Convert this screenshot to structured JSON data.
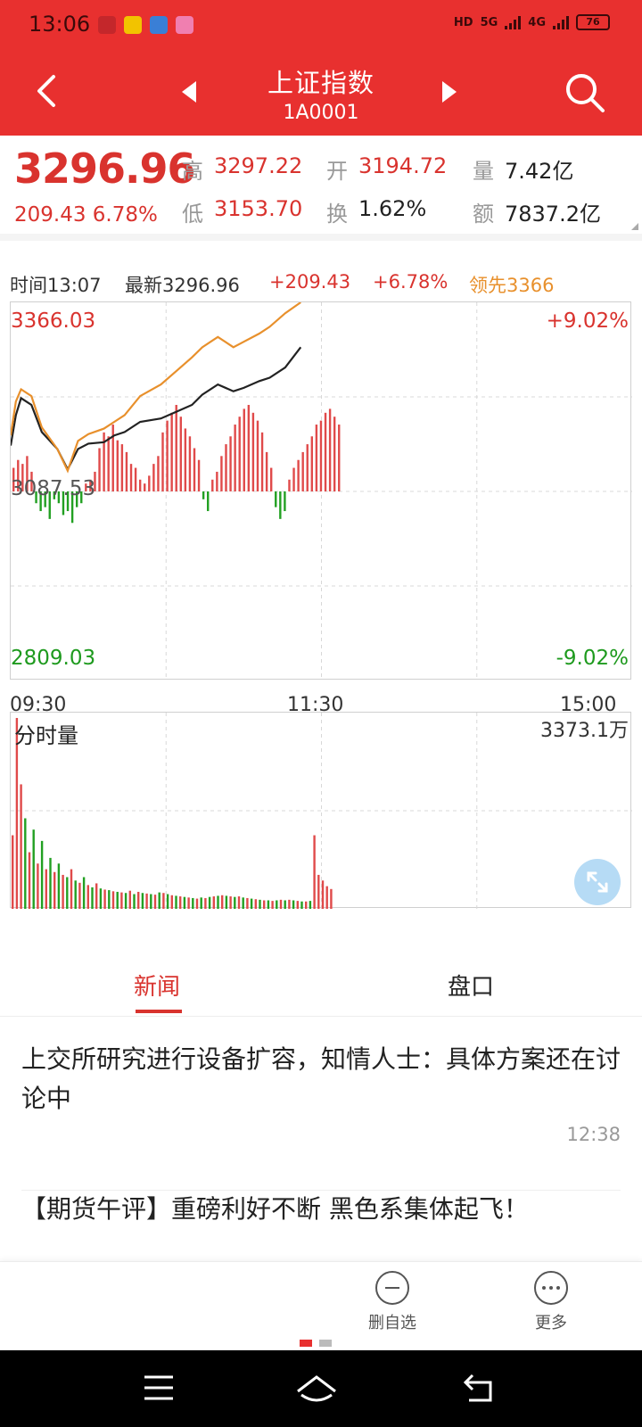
{
  "status_bar": {
    "time": "13:06",
    "network": "5G",
    "network2": "4G",
    "battery": "76",
    "app_colors": [
      "#c4272b",
      "#f2c300",
      "#3a7fd6",
      "#f07fb0"
    ]
  },
  "header": {
    "title": "上证指数",
    "code": "1A0001"
  },
  "quote": {
    "price": "3296.96",
    "change": "209.43",
    "change_pct": "6.78%",
    "high_label": "高",
    "high": "3297.22",
    "low_label": "低",
    "low": "3153.70",
    "open_label": "开",
    "open": "3194.72",
    "turnover_label": "换",
    "turnover": "1.62%",
    "volume_label": "量",
    "volume": "7.42亿",
    "amount_label": "额",
    "amount": "7837.2亿"
  },
  "info_row": {
    "time": "时间13:07",
    "latest": "最新3296.96",
    "change": "+209.43",
    "change_pct": "+6.78%",
    "lead": "领先3366"
  },
  "price_chart": {
    "top_value": "3366.03",
    "top_pct": "+9.02%",
    "mid_value": "3087.53",
    "bottom_value": "2809.03",
    "bottom_pct": "-9.02%",
    "time_start": "09:30",
    "time_mid": "11:30",
    "time_end": "15:00"
  },
  "volume_chart": {
    "label": "分时量",
    "max": "3373.1万"
  },
  "chart_data": [
    {
      "type": "line",
      "ylim": [
        2809.03,
        3366.03
      ],
      "x": [
        0,
        2,
        4,
        8,
        12,
        18,
        22,
        26,
        30,
        36,
        40,
        44,
        50,
        58,
        64,
        70,
        74,
        80,
        86,
        90,
        96,
        100,
        106,
        112
      ],
      "series": [
        {
          "values": [
            3155,
            3200,
            3225,
            3215,
            3175,
            3150,
            3120,
            3150,
            3158,
            3160,
            3170,
            3175,
            3190,
            3195,
            3205,
            3215,
            3230,
            3245,
            3235,
            3240,
            3250,
            3255,
            3270,
            3300
          ],
          "color": "#222222"
        },
        {
          "values": [
            3170,
            3220,
            3238,
            3228,
            3182,
            3150,
            3118,
            3162,
            3172,
            3180,
            3190,
            3200,
            3228,
            3245,
            3265,
            3285,
            3300,
            3315,
            3300,
            3308,
            3320,
            3330,
            3350,
            3366
          ],
          "color": "#e8902c"
        }
      ],
      "columns": {
        "values": [
          12,
          16,
          14,
          18,
          10,
          -6,
          -10,
          -8,
          -14,
          -4,
          -6,
          -12,
          -10,
          -16,
          -8,
          -6,
          4,
          6,
          10,
          22,
          30,
          28,
          34,
          26,
          24,
          20,
          14,
          12,
          6,
          4,
          8,
          14,
          18,
          30,
          36,
          40,
          44,
          38,
          32,
          28,
          22,
          16,
          -4,
          -10,
          6,
          10,
          18,
          24,
          28,
          34,
          38,
          42,
          44,
          40,
          36,
          30,
          20,
          12,
          -8,
          -14,
          -10,
          6,
          12,
          16,
          20,
          24,
          28,
          34,
          36,
          40,
          42,
          38,
          34
        ],
        "ylim": [
          -50,
          50
        ]
      }
    },
    {
      "type": "bar",
      "ylim": [
        0,
        3373.1
      ],
      "values": [
        1300,
        3373,
        2200,
        1600,
        1000,
        1400,
        800,
        1200,
        700,
        900,
        650,
        800,
        600,
        560,
        700,
        500,
        460,
        560,
        420,
        380,
        450,
        360,
        340,
        330,
        310,
        300,
        290,
        280,
        320,
        260,
        300,
        280,
        270,
        260,
        250,
        290,
        280,
        260,
        240,
        230,
        220,
        210,
        200,
        190,
        180,
        200,
        190,
        210,
        220,
        230,
        240,
        230,
        220,
        210,
        220,
        200,
        190,
        180,
        170,
        160,
        150,
        150,
        140,
        150,
        160,
        150,
        160,
        150,
        140,
        130,
        130,
        140,
        1300,
        600,
        500,
        400,
        350
      ],
      "colors_pattern": [
        "red",
        "green"
      ]
    }
  ],
  "tabs": [
    {
      "label": "新闻"
    },
    {
      "label": "盘口"
    }
  ],
  "news": [
    {
      "title": "上交所研究进行设备扩容，知情人士：具体方案还在讨论中",
      "time": "12:38"
    },
    {
      "title": "【期货午评】重磅利好不断 黑色系集体起飞！"
    }
  ],
  "actions": [
    {
      "label": "删自选",
      "icon": "minus-circle-icon"
    },
    {
      "label": "更多",
      "icon": "more-circle-icon"
    }
  ]
}
